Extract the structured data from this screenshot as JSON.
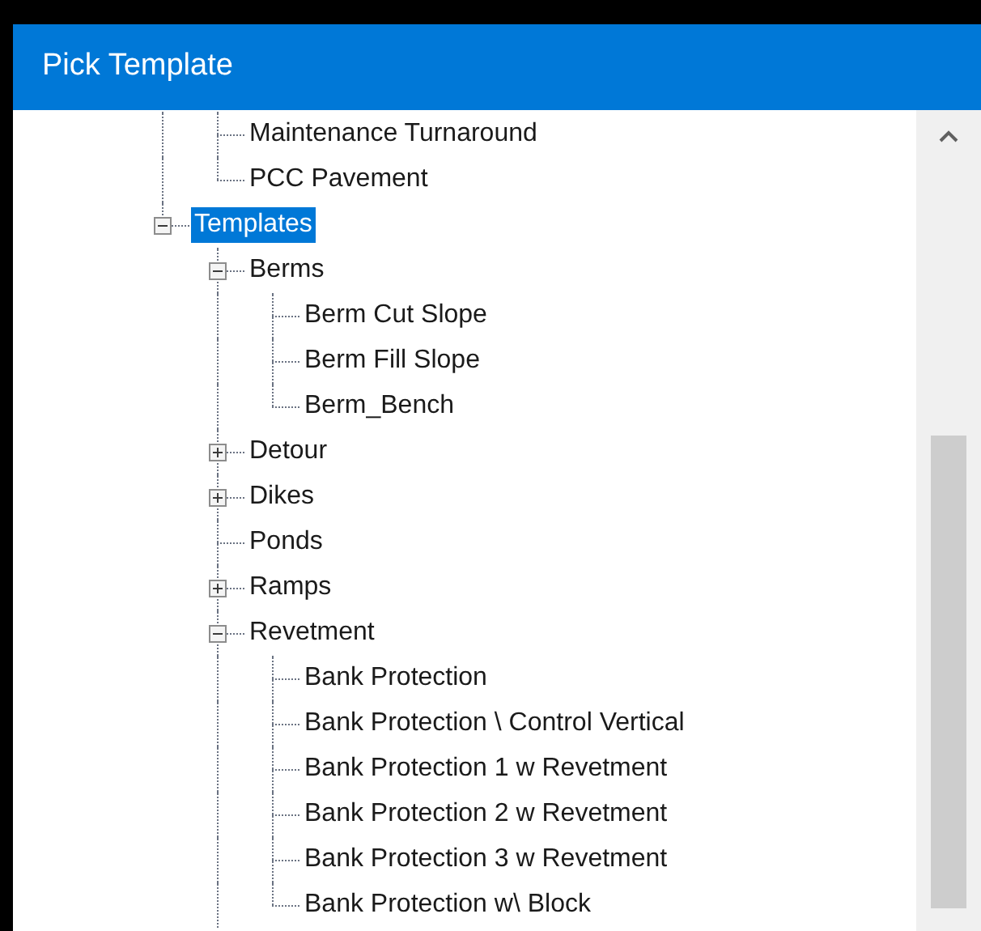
{
  "window": {
    "title": "Pick Template"
  },
  "tree": {
    "items": [
      {
        "kind": "cut_branch",
        "children": [
          {
            "label": "Maintenance Turnaround",
            "selected": false
          },
          {
            "label": "PCC Pavement",
            "selected": false
          }
        ]
      },
      {
        "label": "Templates",
        "selected": true,
        "expanded": true,
        "children": [
          {
            "label": "Berms",
            "selected": false,
            "expanded": true,
            "children": [
              {
                "label": "Berm Cut Slope",
                "selected": false
              },
              {
                "label": "Berm Fill Slope",
                "selected": false
              },
              {
                "label": "Berm_Bench",
                "selected": false
              }
            ]
          },
          {
            "label": "Detour",
            "selected": false,
            "expanded": false
          },
          {
            "label": "Dikes",
            "selected": false,
            "expanded": false
          },
          {
            "label": "Ponds",
            "selected": false
          },
          {
            "label": "Ramps",
            "selected": false,
            "expanded": false
          },
          {
            "label": "Revetment",
            "selected": false,
            "expanded": true,
            "line_continues": true,
            "children": [
              {
                "label": "Bank Protection",
                "selected": false
              },
              {
                "label": "Bank Protection \\ Control Vertical",
                "selected": false
              },
              {
                "label": "Bank Protection 1 w Revetment",
                "selected": false
              },
              {
                "label": "Bank Protection 2 w Revetment",
                "selected": false
              },
              {
                "label": "Bank Protection 3 w Revetment",
                "selected": false
              },
              {
                "label": "Bank Protection w\\ Block",
                "selected": false
              }
            ]
          }
        ]
      }
    ]
  }
}
